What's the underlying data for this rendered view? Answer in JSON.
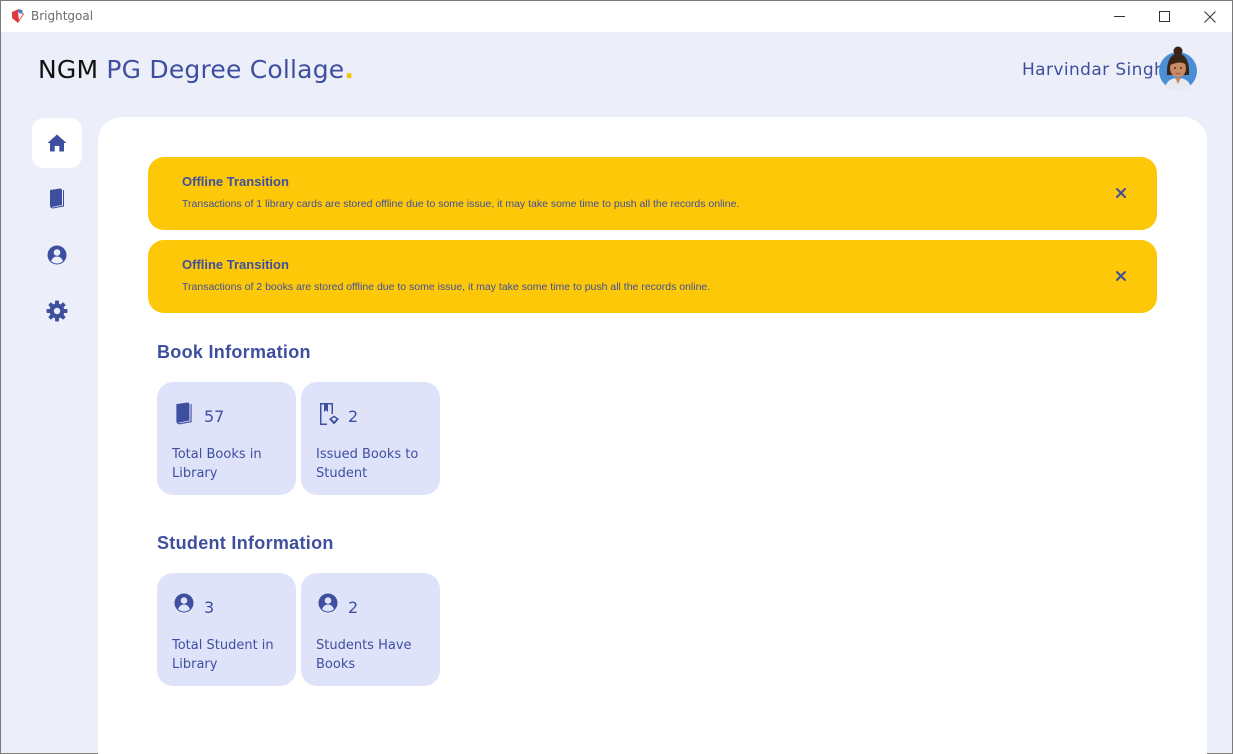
{
  "app": {
    "title": "Brightgoal"
  },
  "header": {
    "brand_prefix": "NGM",
    "brand_name": "PG Degree Collage",
    "brand_dot": ".",
    "user_name": "Harvindar Singh"
  },
  "sidebar": {
    "items": [
      {
        "icon": "home-icon",
        "active": true
      },
      {
        "icon": "book-icon",
        "active": false
      },
      {
        "icon": "user-circle-icon",
        "active": false
      },
      {
        "icon": "gear-icon",
        "active": false
      }
    ]
  },
  "alerts": [
    {
      "title": "Offline Transition",
      "message": "Transactions of 1 library cards are stored offline due to some issue, it may take some time to push all the records online."
    },
    {
      "title": "Offline Transition",
      "message": "Transactions of 2 books are stored offline due to some issue, it may take some time to push all the records online."
    }
  ],
  "book_info": {
    "title": "Book Information",
    "cards": [
      {
        "icon": "book-icon",
        "value": "57",
        "label": "Total Books in Library"
      },
      {
        "icon": "book-bookmark-icon",
        "value": "2",
        "label": "Issued Books to Student"
      }
    ]
  },
  "student_info": {
    "title": "Student Information",
    "cards": [
      {
        "icon": "user-circle-icon",
        "value": "3",
        "label": "Total Student in Library"
      },
      {
        "icon": "user-circle-icon",
        "value": "2",
        "label": "Students Have Books"
      }
    ]
  },
  "colors": {
    "accent": "#3f4f9f",
    "alert_bg": "#fdc808",
    "card_bg": "#dfe3fa",
    "page_bg": "#eceffa"
  }
}
